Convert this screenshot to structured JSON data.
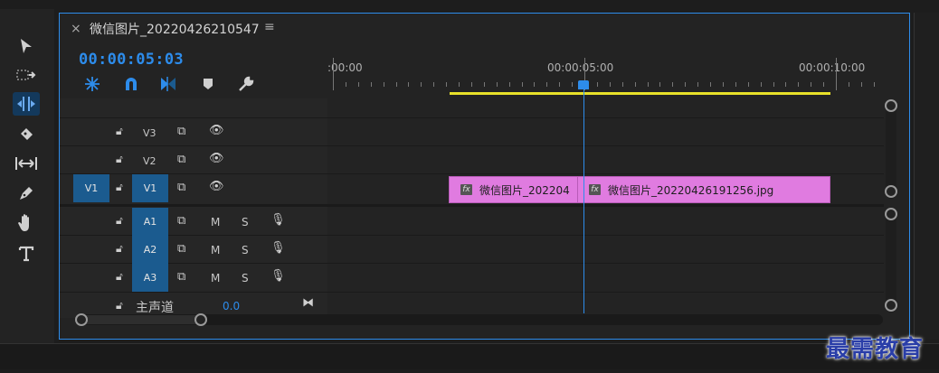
{
  "sequence": {
    "tab_close": "×",
    "title": "微信图片_20220426210547",
    "menu": "≡",
    "timecode": "00:00:05:03"
  },
  "ruler": {
    "labels": [
      ":00:00",
      "00:00:05:00",
      "00:00:10:00"
    ]
  },
  "tracks": {
    "video": [
      {
        "name": "V3",
        "source": "",
        "targeted": false
      },
      {
        "name": "V2",
        "source": "",
        "targeted": false
      },
      {
        "name": "V1",
        "source": "V1",
        "targeted": true
      }
    ],
    "audio": [
      {
        "name": "A1",
        "mute": "M",
        "solo": "S"
      },
      {
        "name": "A2",
        "mute": "M",
        "solo": "S"
      },
      {
        "name": "A3",
        "mute": "M",
        "solo": "S"
      }
    ],
    "master": {
      "label": "主声道",
      "value": "0.0"
    }
  },
  "clips": [
    {
      "label": "微信图片_202204",
      "fx": "fx"
    },
    {
      "label": "微信图片_20220426191256.jpg",
      "fx": "fx"
    }
  ],
  "watermark": "最需教育",
  "colors": {
    "accent": "#2d8ceb",
    "clip": "#e07be0",
    "workarea": "#e8e12a",
    "track_target": "#1b5b8f"
  }
}
